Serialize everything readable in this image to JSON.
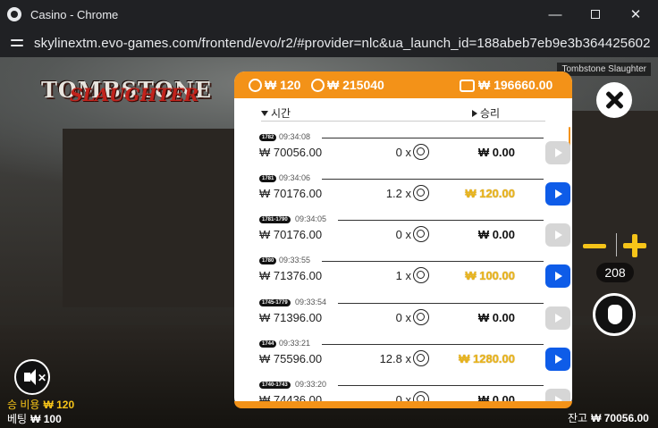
{
  "window": {
    "title": "Casino - Chrome",
    "minimize": "—",
    "close": "✕"
  },
  "address": {
    "url": "skylinextm.evo-games.com/frontend/evo/r2/#provider=nlc&ua_launch_id=188abeb7eb9e3b364425602a..."
  },
  "game": {
    "logo_top": "TOMBSTONE",
    "logo_bottom": "SLAUGHTER",
    "tag": "Tombstone Slaughter"
  },
  "panel": {
    "header": {
      "bet": "₩ 120",
      "total_bet": "₩ 215040",
      "balance": "₩ 196660.00"
    },
    "col_time": "시간",
    "col_win": "승리",
    "rows": [
      {
        "badge": "1782",
        "time": "09:34:08",
        "balance": "₩ 70056.00",
        "mult": "0 x",
        "win": "₩ 0.00",
        "gold": false
      },
      {
        "badge": "1781",
        "time": "09:34:06",
        "balance": "₩ 70176.00",
        "mult": "1.2 x",
        "win": "₩ 120.00",
        "gold": true
      },
      {
        "badge": "1781-1790",
        "time": "09:34:05",
        "balance": "₩ 70176.00",
        "mult": "0 x",
        "win": "₩ 0.00",
        "gold": false
      },
      {
        "badge": "1780",
        "time": "09:33:55",
        "balance": "₩ 71376.00",
        "mult": "1 x",
        "win": "₩ 100.00",
        "gold": true
      },
      {
        "badge": "1745-1779",
        "time": "09:33:54",
        "balance": "₩ 71396.00",
        "mult": "0 x",
        "win": "₩ 0.00",
        "gold": false
      },
      {
        "badge": "1744",
        "time": "09:33:21",
        "balance": "₩ 75596.00",
        "mult": "12.8 x",
        "win": "₩ 1280.00",
        "gold": true
      },
      {
        "badge": "1740-1743",
        "time": "09:33:20",
        "balance": "₩ 74436.00",
        "mult": "0 x",
        "win": "₩ 0.00",
        "gold": false
      }
    ]
  },
  "controls": {
    "bet_count": "208"
  },
  "footer": {
    "win_label": "승 비용",
    "win_value": "₩ 120",
    "bet_label": "베팅",
    "bet_value": "₩ 100",
    "balance_label": "잔고",
    "balance_value": "₩ 70056.00"
  },
  "colors": {
    "accent": "#f39218",
    "gold": "#f6c419",
    "play_active": "#0e5ce8"
  }
}
